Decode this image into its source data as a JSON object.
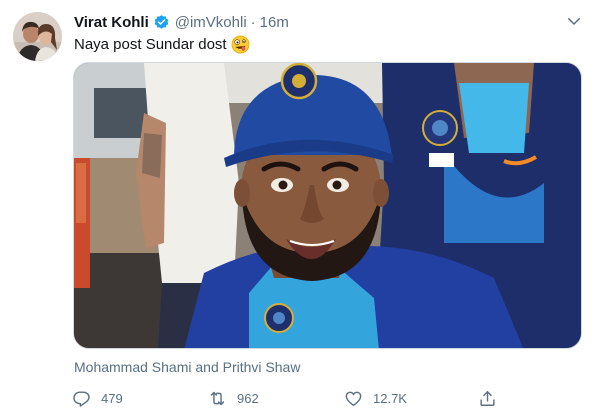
{
  "tweet": {
    "author_name": "Virat Kohli",
    "verified": true,
    "handle": "@imVkohli",
    "separator": "·",
    "time": "16m",
    "text": "Naya post Sundar dost",
    "emoji": "zany-face-emoji",
    "tagged_people": "Mohammad Shami and Prithvi Shaw"
  },
  "actions": {
    "replies": "479",
    "retweets": "962",
    "likes": "12.7K"
  },
  "icons": {
    "reply": "reply-icon",
    "retweet": "retweet-icon",
    "like": "heart-icon",
    "share": "share-icon",
    "more": "chevron-down-icon",
    "verified": "verified-badge-icon"
  },
  "colors": {
    "accent": "#1da1f2",
    "secondary_text": "#5b7083",
    "primary_text": "#0f1419"
  }
}
